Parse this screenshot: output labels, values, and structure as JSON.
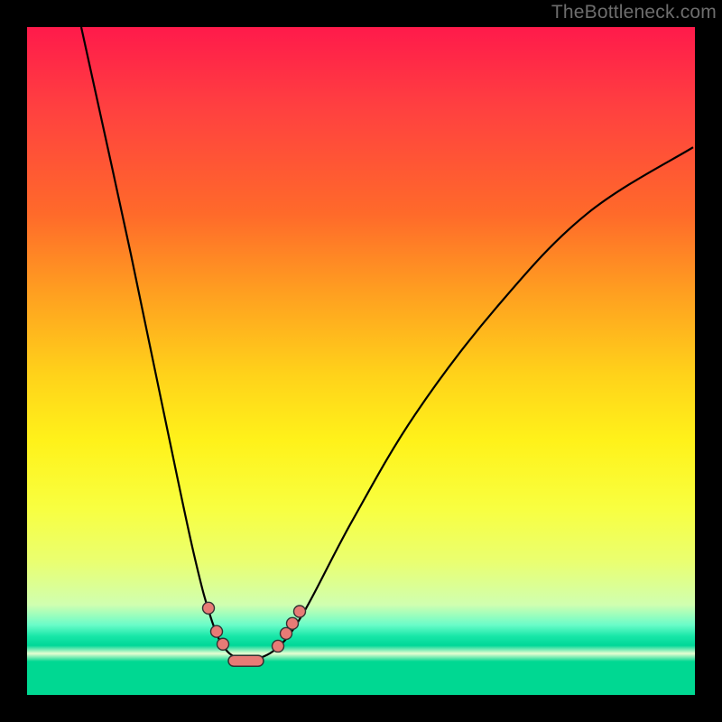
{
  "watermark": "TheBottleneck.com",
  "chart_data": {
    "type": "line",
    "title": "",
    "xlabel": "",
    "ylabel": "",
    "x_range": [
      0,
      740
    ],
    "y_range_percent": [
      0,
      100
    ],
    "note": "Stylized bottleneck curve; y ≈ 100 at edges, dips to ≈ 5 near x≈245. Left branch falls steeply from top-left; right branch rises to top-right with shallower slope. Markers cluster near the trough.",
    "curve_left": [
      {
        "x": 60,
        "y_pct": 100
      },
      {
        "x": 115,
        "y_pct": 66
      },
      {
        "x": 155,
        "y_pct": 40
      },
      {
        "x": 185,
        "y_pct": 21
      },
      {
        "x": 205,
        "y_pct": 11
      },
      {
        "x": 222,
        "y_pct": 6.5
      },
      {
        "x": 245,
        "y_pct": 5
      }
    ],
    "curve_right": [
      {
        "x": 245,
        "y_pct": 5
      },
      {
        "x": 275,
        "y_pct": 6.8
      },
      {
        "x": 305,
        "y_pct": 12
      },
      {
        "x": 360,
        "y_pct": 26
      },
      {
        "x": 430,
        "y_pct": 42
      },
      {
        "x": 520,
        "y_pct": 58
      },
      {
        "x": 620,
        "y_pct": 72
      },
      {
        "x": 738,
        "y_pct": 82
      }
    ],
    "markers_left": [
      {
        "x": 201,
        "y_pct": 13
      },
      {
        "x": 210,
        "y_pct": 9.5
      },
      {
        "x": 217,
        "y_pct": 7.6
      }
    ],
    "markers_right": [
      {
        "x": 278,
        "y_pct": 7.3
      },
      {
        "x": 287,
        "y_pct": 9.2
      },
      {
        "x": 294,
        "y_pct": 10.7
      },
      {
        "x": 302,
        "y_pct": 12.5
      }
    ],
    "trough_pill": {
      "x0": 223,
      "x1": 262,
      "y_pct": 5.1
    }
  }
}
